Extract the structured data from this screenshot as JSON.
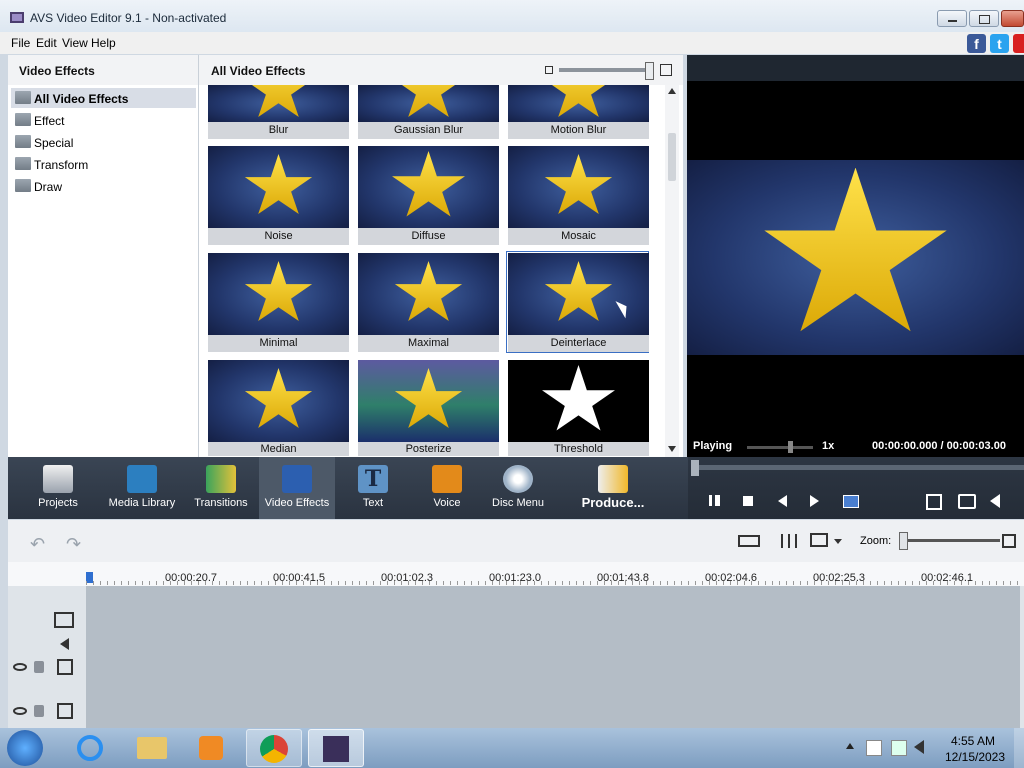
{
  "window": {
    "title": "AVS Video Editor 9.1 - Non-activated"
  },
  "menu": [
    "File",
    "Edit",
    "View",
    "Help"
  ],
  "left_panel": {
    "title": "Video Effects",
    "items": [
      "All Video Effects",
      "Effect",
      "Special",
      "Transform",
      "Draw"
    ]
  },
  "grid": {
    "title": "All Video Effects",
    "effects": [
      "Blur",
      "Gaussian Blur",
      "Motion Blur",
      "Noise",
      "Diffuse",
      "Mosaic",
      "Minimal",
      "Maximal",
      "Deinterlace",
      "Median",
      "Posterize",
      "Threshold"
    ],
    "selected": "Deinterlace"
  },
  "player": {
    "status": "Playing",
    "speed": "1x",
    "time": "00:00:00.000 / 00:00:03.00"
  },
  "toolbar": [
    "Projects",
    "Media Library",
    "Transitions",
    "Video Effects",
    "Text",
    "Voice",
    "Disc Menu",
    "Produce..."
  ],
  "timeline": {
    "zoom_label": "Zoom:",
    "ticks": [
      "00:00:20.7",
      "00:00:41.5",
      "00:01:02.3",
      "00:01:23.0",
      "00:01:43.8",
      "00:02:04.6",
      "00:02:25.3",
      "00:02:46.1"
    ]
  },
  "taskbar": {
    "time": "4:55 AM",
    "date": "12/15/2023"
  },
  "colors": {
    "toolbar_bg": "#2f3946",
    "accent_selected": "#3a6fc4"
  }
}
